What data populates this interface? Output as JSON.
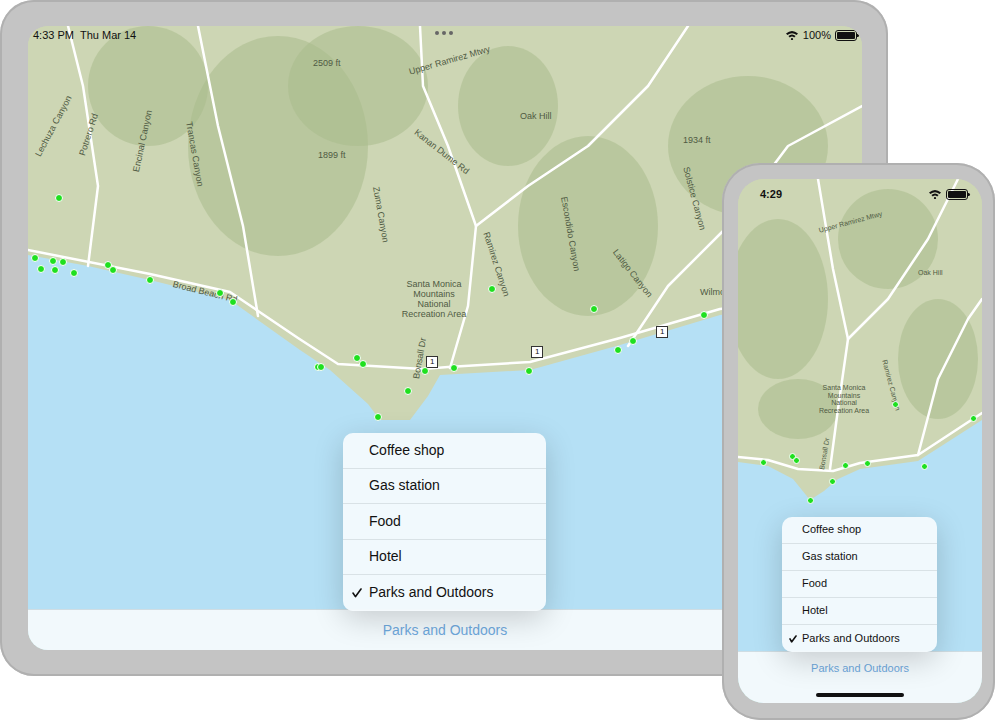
{
  "ipad": {
    "status_bar": {
      "time": "4:33 PM",
      "date": "Thu Mar 14",
      "battery": "100%",
      "battery_level": 1
    },
    "map_labels": [
      "Oak Hill",
      "Santa Monica Mountains National Recreation Area",
      "Zuma Canyon",
      "Ramirez Canyon",
      "Escondido Canyon",
      "Latigo Canyon",
      "Solstice Canyon",
      "Trancas Canyon",
      "Encinal Canyon",
      "Lechuza Canyon",
      "Kanan Dume Rd",
      "Upper Ramirez Mtwy",
      "Bonsall Dr",
      "Broad Beach Rd",
      "2509 ft",
      "1899 ft",
      "1934 ft",
      "Wilmott Ct",
      "Potrero Rd"
    ],
    "route_shields": [
      "1",
      "1",
      "1"
    ],
    "menu": {
      "items": [
        {
          "label": "Coffee shop",
          "selected": false
        },
        {
          "label": "Gas station",
          "selected": false
        },
        {
          "label": "Food",
          "selected": false
        },
        {
          "label": "Hotel",
          "selected": false
        },
        {
          "label": "Parks and Outdoors",
          "selected": true
        }
      ]
    },
    "toolbar": {
      "button": "Parks and Outdoors"
    }
  },
  "iphone": {
    "status_bar": {
      "time": "4:29",
      "battery_level": 1
    },
    "map_labels": [
      "Oak Hill",
      "Ramirez Canyon",
      "Santa Monica Mountains National Recreation Area",
      "Upper Ramirez Mtwy",
      "Bonsall Dr"
    ],
    "menu": {
      "items": [
        {
          "label": "Coffee shop",
          "selected": false
        },
        {
          "label": "Gas station",
          "selected": false
        },
        {
          "label": "Food",
          "selected": false
        },
        {
          "label": "Hotel",
          "selected": false
        },
        {
          "label": "Parks and Outdoors",
          "selected": true
        }
      ]
    },
    "toolbar": {
      "button": "Parks and Outdoors"
    }
  }
}
